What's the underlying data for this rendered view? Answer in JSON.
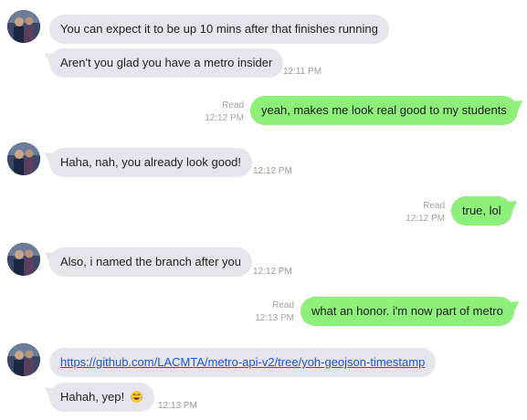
{
  "conversation": {
    "messages": [
      {
        "text": "You can expect it to be up 10 mins after that finishes running"
      },
      {
        "text": "Aren't you glad you have a metro insider",
        "time": "12:11 PM"
      },
      {
        "text": "yeah, makes me look real good to my students",
        "status": "Read",
        "time": "12:12 PM"
      },
      {
        "text": "Haha, nah, you already look good!",
        "time": "12:12 PM"
      },
      {
        "text": "true, lol",
        "status": "Read",
        "time": "12:12 PM"
      },
      {
        "text": "Also, i named the branch after you",
        "time": "12:12 PM"
      },
      {
        "text": "what an honor. i'm now part of metro",
        "status": "Read",
        "time": "12:13 PM"
      },
      {
        "link": "https://github.com/LACMTA/metro-api-v2/tree/yoh-geojson-timestamp"
      },
      {
        "text": "Hahah, yep!",
        "emoji": "face-with-tears-of-joy",
        "time": "12:13 PM"
      }
    ]
  },
  "colors": {
    "incoming_bubble": "#e6e5eb",
    "outgoing_bubble": "#8ef07a",
    "link": "#1a57d6",
    "timestamp": "#9a9a9a"
  },
  "icons": {
    "avatar": "contact-avatar-photo",
    "emoji": "face-with-tears-of-joy"
  }
}
